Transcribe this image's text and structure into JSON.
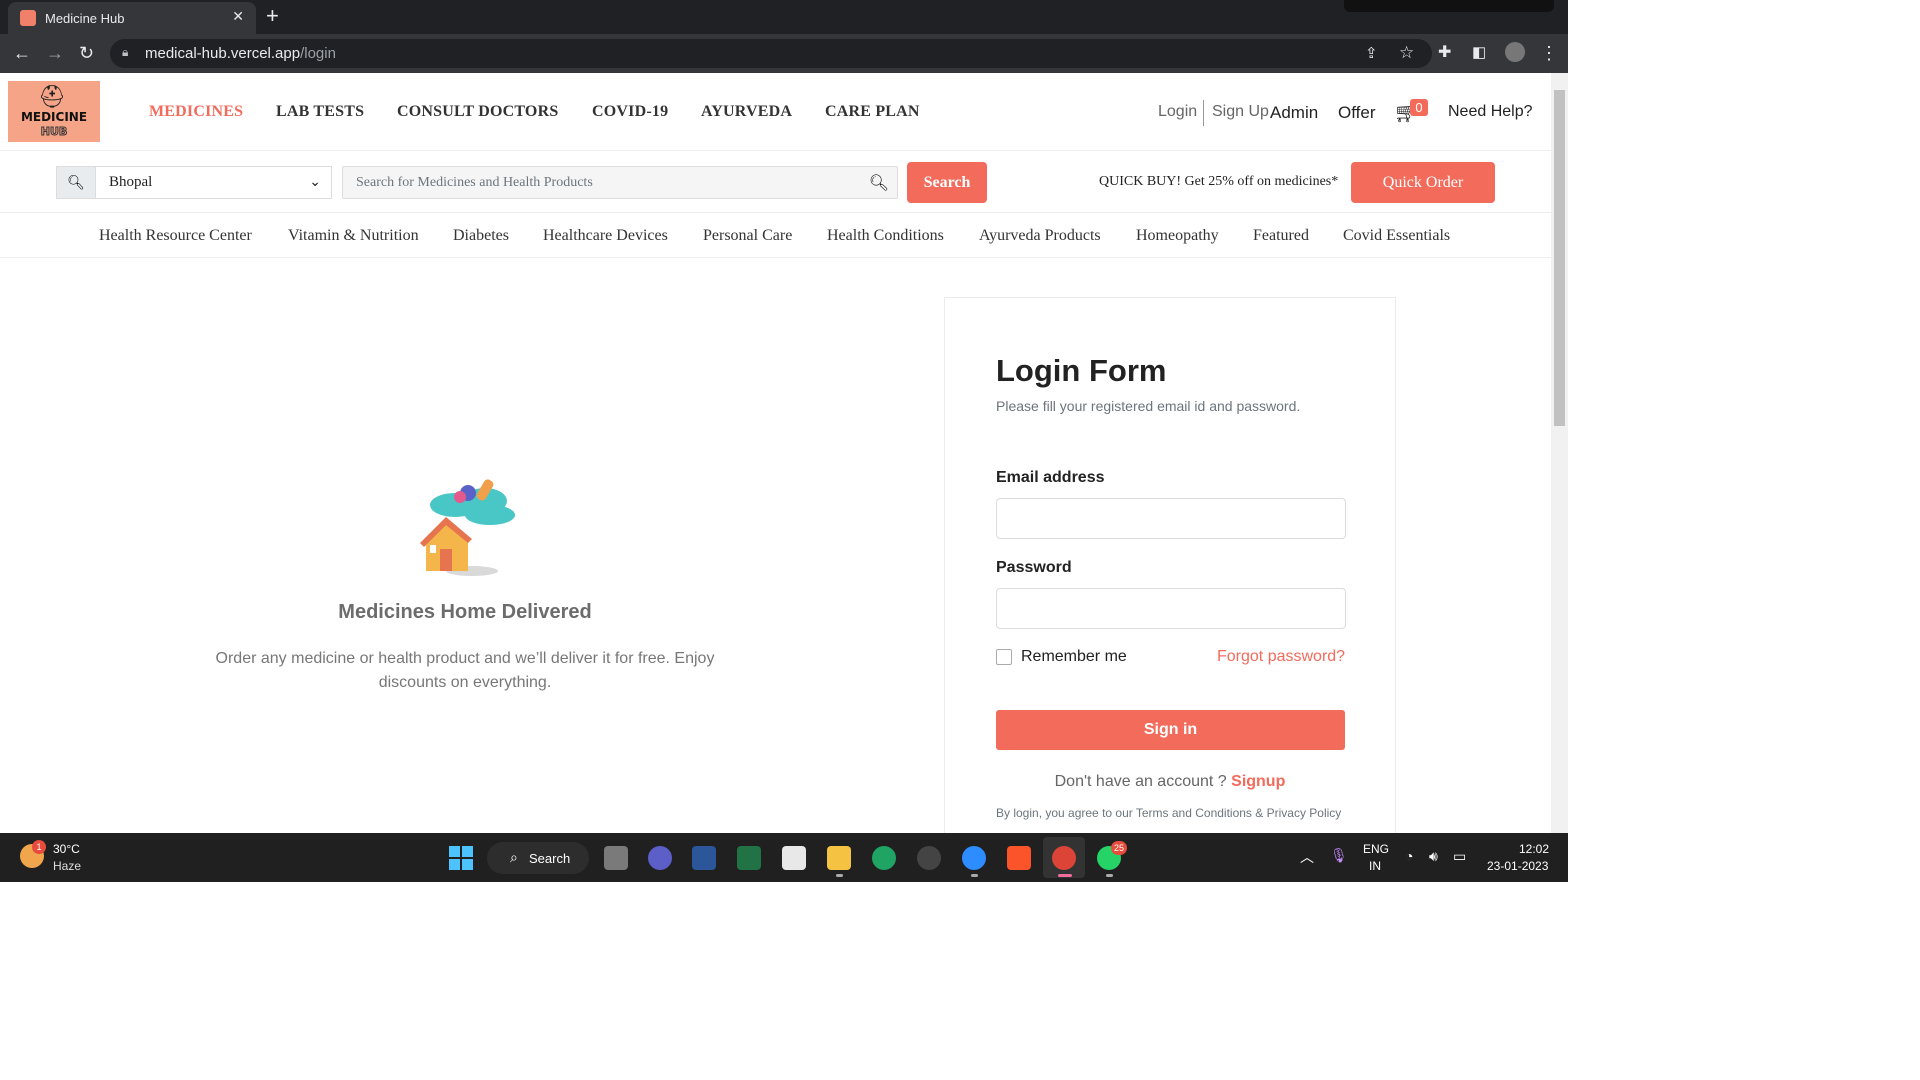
{
  "browser": {
    "tab_title": "Medicine Hub",
    "url_host": "medical-hub.vercel.app",
    "url_path": "/login"
  },
  "header": {
    "logo_text_1": "MEDICINE",
    "logo_text_2": "HUB",
    "nav": [
      "MEDICINES",
      "LAB TESTS",
      "CONSULT DOCTORS",
      "COVID-19",
      "AYURVEDA",
      "CARE PLAN"
    ],
    "login": "Login",
    "signup": "Sign Up",
    "admin": "Admin",
    "offer": "Offer",
    "cart_count": "0",
    "help": "Need Help?"
  },
  "search": {
    "location": "Bhopal",
    "placeholder": "Search for Medicines and Health Products",
    "button": "Search",
    "promo": "QUICK BUY! Get 25% off on medicines*",
    "quick_order": "Quick Order"
  },
  "categories": [
    "Health Resource Center",
    "Vitamin & Nutrition",
    "Diabetes",
    "Healthcare Devices",
    "Personal Care",
    "Health Conditions",
    "Ayurveda Products",
    "Homeopathy",
    "Featured",
    "Covid Essentials"
  ],
  "promo_panel": {
    "title": "Medicines Home Delivered",
    "description": "Order any medicine or health product and we’ll deliver it for free. Enjoy discounts on everything."
  },
  "login_form": {
    "title": "Login Form",
    "subtitle": "Please fill your registered email id and password.",
    "email_label": "Email address",
    "password_label": "Password",
    "remember": "Remember me",
    "forgot": "Forgot password?",
    "signin": "Sign in",
    "no_account": "Don't have an account ?",
    "signup_link": "Signup",
    "terms": "By login, you agree to our Terms and Conditions & Privacy Policy"
  },
  "taskbar": {
    "weather_badge": "1",
    "temperature": "30°C",
    "condition": "Haze",
    "search": "Search",
    "whatsapp_badge": "25",
    "lang1": "ENG",
    "lang2": "IN",
    "time": "12:02",
    "date": "23-01-2023"
  },
  "colors": {
    "accent": "#f26b5b",
    "logo_bg": "#f6a488"
  }
}
